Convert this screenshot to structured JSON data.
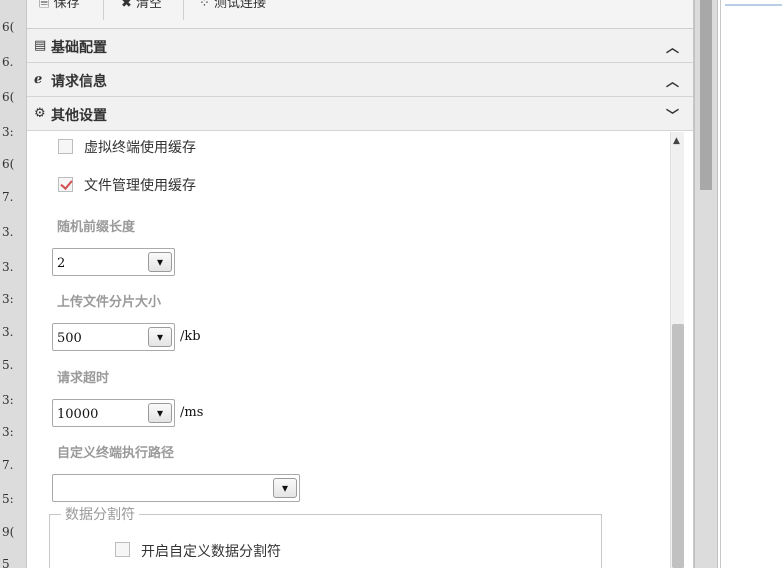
{
  "left_numbers": [
    "6(",
    "6.",
    "6(",
    "3:",
    "6(",
    "7.",
    "3.",
    "3.",
    "3:",
    "3.",
    "5.",
    "3:",
    "3:",
    "7.",
    "5:",
    "9(",
    "5"
  ],
  "toolbar": {
    "save_label": "保存",
    "clear_label": "清空",
    "test_label": "测试连接"
  },
  "sections": {
    "basic": {
      "title": "基础配置",
      "icon": "file-icon",
      "state": "collapsed"
    },
    "request": {
      "title": "请求信息",
      "icon": "browser-icon",
      "state": "collapsed"
    },
    "other": {
      "title": "其他设置",
      "icon": "gears-icon",
      "state": "expanded"
    }
  },
  "other_settings": {
    "virtual_terminal_cache": {
      "label": "虚拟终端使用缓存",
      "checked": false
    },
    "file_manager_cache": {
      "label": "文件管理使用缓存",
      "checked": true
    },
    "random_prefix_length": {
      "label": "随机前缀长度",
      "value": "2"
    },
    "upload_chunk_size": {
      "label": "上传文件分片大小",
      "value": "500",
      "unit": "/kb"
    },
    "request_timeout": {
      "label": "请求超时",
      "value": "10000",
      "unit": "/ms"
    },
    "custom_terminal_path": {
      "label": "自定义终端执行路径",
      "value": ""
    },
    "data_separator": {
      "legend": "数据分割符",
      "enable_custom": {
        "label": "开启自定义数据分割符",
        "checked": false
      }
    }
  },
  "colors": {
    "accent_check": "#d05050",
    "field_label": "#9a9a9a",
    "header_bg": "#f1f1f1"
  }
}
